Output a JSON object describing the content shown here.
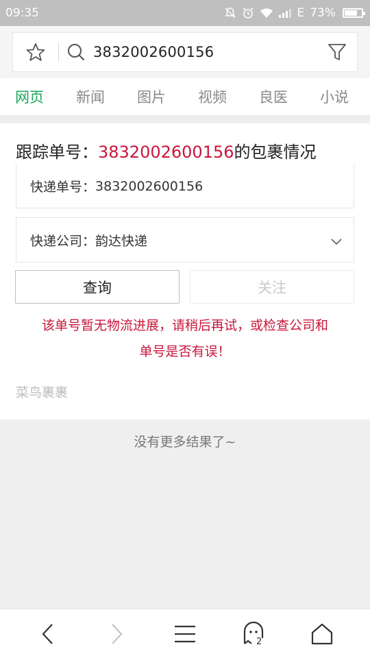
{
  "status_bar": {
    "time": "09:35",
    "network": "E",
    "battery": "73%",
    "battery_level": 0.73
  },
  "search": {
    "query": "3832002600156"
  },
  "tabs": [
    {
      "label": "网页",
      "active": true
    },
    {
      "label": "新闻",
      "active": false
    },
    {
      "label": "图片",
      "active": false
    },
    {
      "label": "视频",
      "active": false
    },
    {
      "label": "良医",
      "active": false
    },
    {
      "label": "小说",
      "active": false
    }
  ],
  "card": {
    "title_prefix": "跟踪单号：",
    "title_number": "3832002600156",
    "title_suffix": "的包裹情况",
    "tracking_label": "快递单号：",
    "tracking_value": "3832002600156",
    "company_label": "快递公司：",
    "company_value": "韵达快递",
    "query_button": "查询",
    "follow_button": "关注",
    "error_line1": "该单号暂无物流进展，请稍后再试，或检查公司和",
    "error_line2": "单号是否有误！",
    "source": "菜鸟裹裹"
  },
  "footer": {
    "no_more": "没有更多结果了~"
  },
  "bottom_nav": {
    "tabs_count": "2"
  },
  "colors": {
    "accent_green": "#1aa35a",
    "highlight_red": "#c8163a"
  }
}
